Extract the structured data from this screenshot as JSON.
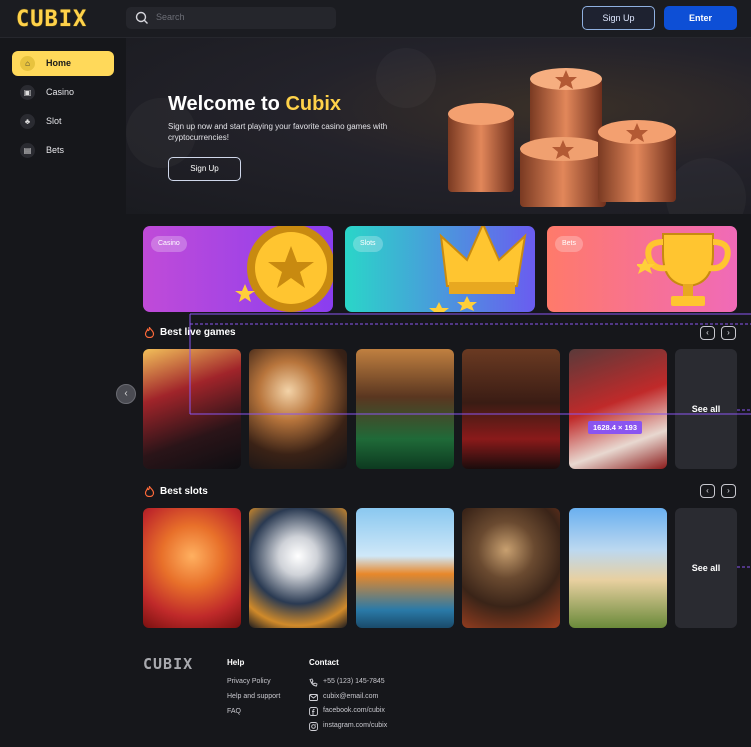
{
  "header": {
    "logo": "CUBIX",
    "search_placeholder": "Search",
    "signup_label": "Sign Up",
    "enter_label": "Enter"
  },
  "sidebar": {
    "items": [
      {
        "label": "Home",
        "icon": "home-icon",
        "active": true
      },
      {
        "label": "Casino",
        "icon": "casino-icon",
        "active": false
      },
      {
        "label": "Slot",
        "icon": "slot-icon",
        "active": false
      },
      {
        "label": "Bets",
        "icon": "bets-icon",
        "active": false
      }
    ]
  },
  "hero": {
    "title_prefix": "Welcome to ",
    "title_accent": "Cubix",
    "subtitle": "Sign up now and start playing your favorite casino games with cryptocurrencies!",
    "button_label": "Sign Up"
  },
  "categories": [
    {
      "label": "Casino",
      "color_from": "#c04bd8",
      "color_to": "#8a3ef0"
    },
    {
      "label": "Slots",
      "color_from": "#2ad6c8",
      "color_to": "#6a5cf0"
    },
    {
      "label": "Bets",
      "color_from": "#ff7a6a",
      "color_to": "#f06ab8"
    }
  ],
  "live_games": {
    "title": "Best live games",
    "see_all": "See all",
    "cards": [
      "slot-machines-hall",
      "excited-woman-player",
      "dealer-at-table",
      "smiling-woman-roulette",
      "casino-chips-stack"
    ]
  },
  "slots": {
    "title": "Best slots",
    "see_all": "See all",
    "cards": [
      "tiger-fighter",
      "panda-gaming",
      "orange-airplane",
      "spartan-warrior",
      "ancient-city"
    ]
  },
  "overlay": {
    "dimension_badge": "1628.4 × 193"
  },
  "footer": {
    "logo": "CUBIX",
    "help_title": "Help",
    "help_links": [
      "Privacy Policy",
      "Help and support",
      "FAQ"
    ],
    "contact_title": "Contact",
    "contacts": [
      {
        "icon": "phone-icon",
        "text": "+55 (123) 145-7845"
      },
      {
        "icon": "mail-icon",
        "text": "cubix@email.com"
      },
      {
        "icon": "facebook-icon",
        "text": "facebook.com/cubix"
      },
      {
        "icon": "instagram-icon",
        "text": "instagram.com/cubix"
      }
    ]
  },
  "colors": {
    "accent": "#ffd24a",
    "primary_button": "#0d4fd6",
    "background": "#16171b",
    "guide_line": "#8a55f0"
  }
}
